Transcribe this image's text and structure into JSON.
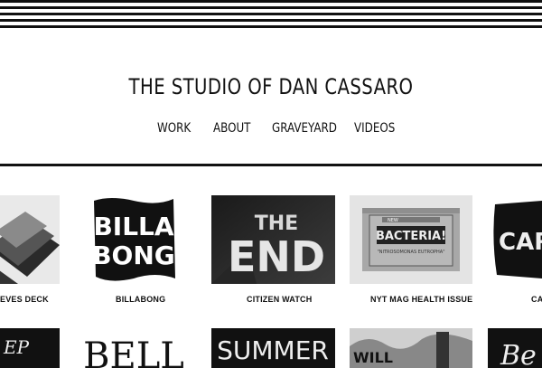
{
  "header": {
    "title": "THE STUDIO OF DAN CASSARO",
    "nav": [
      {
        "label": "WORK"
      },
      {
        "label": "ABOUT"
      },
      {
        "label": "GRAVEYARD"
      },
      {
        "label": "VIDEOS"
      }
    ]
  },
  "projects": [
    {
      "caption": "EVES DECK"
    },
    {
      "caption": "BILLABONG",
      "art_line1": "BILLA",
      "art_line2": "BONG"
    },
    {
      "caption": "CITIZEN WATCH",
      "art_line1": "THE",
      "art_line2": "END"
    },
    {
      "caption": "NYT MAG HEALTH ISSUE",
      "art_main": "BACTERIA!",
      "art_tag": "NEW",
      "art_sub": "\"NITROSOMONAS EUTROPHA\""
    },
    {
      "caption": "CA",
      "art_text": "CARH"
    }
  ],
  "row2": [
    {
      "art_text": "EP"
    },
    {
      "art_text": "BELL"
    },
    {
      "art_text": "SUMMER"
    },
    {
      "art_text": "WILL"
    },
    {
      "art_text": "Be"
    }
  ]
}
